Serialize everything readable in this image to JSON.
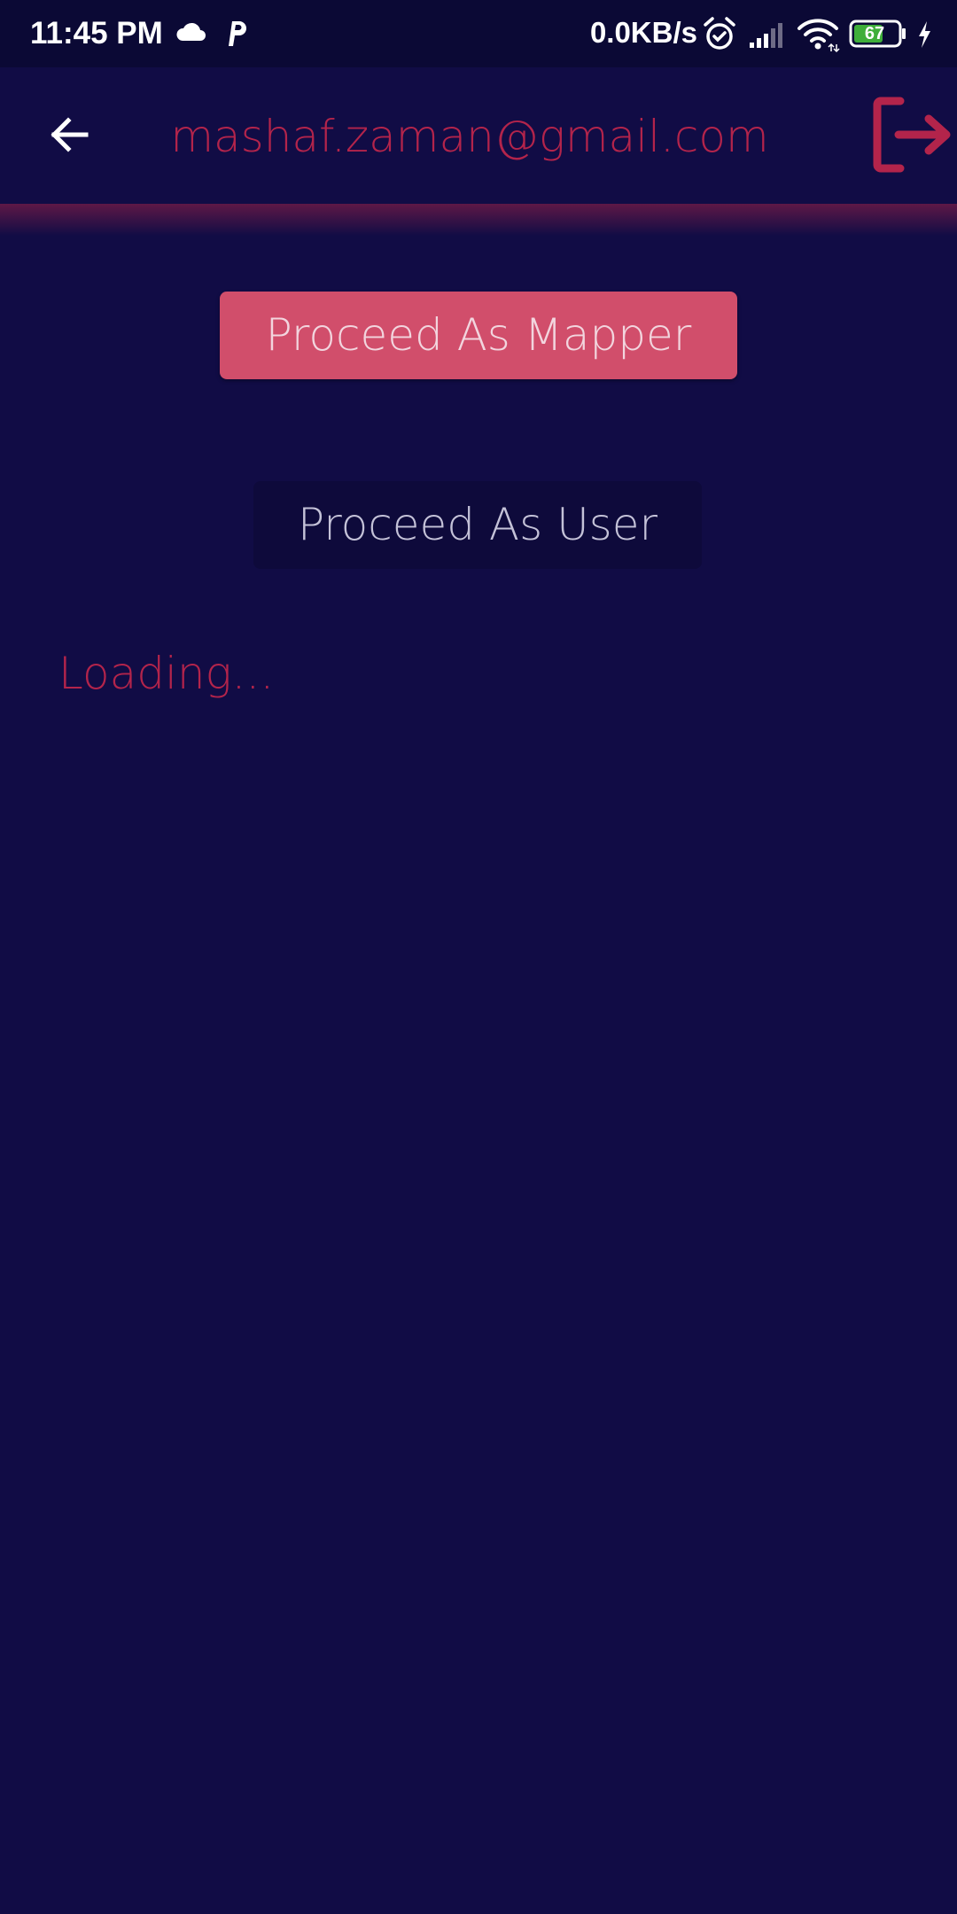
{
  "status_bar": {
    "time": "11:45 PM",
    "network_speed": "0.0KB/s",
    "battery_level": "67",
    "left_icons": [
      "cloud-icon",
      "p-app-icon"
    ],
    "right_icons": [
      "alarm-icon",
      "signal-icon",
      "wifi-icon",
      "battery-icon",
      "charging-icon"
    ]
  },
  "app_bar": {
    "title": "mashaf.zaman@gmail.com",
    "back_icon": "back-arrow-icon",
    "logout_icon": "logout-icon"
  },
  "main": {
    "mapper_button_label": "Proceed As Mapper",
    "user_button_label": "Proceed As User",
    "loading_text": "Loading..."
  },
  "colors": {
    "background": "#110c45",
    "status_bar": "#0b0935",
    "accent": "#b3244b",
    "mapper_button": "#d14e6b",
    "user_button": "#0e0a3b"
  }
}
